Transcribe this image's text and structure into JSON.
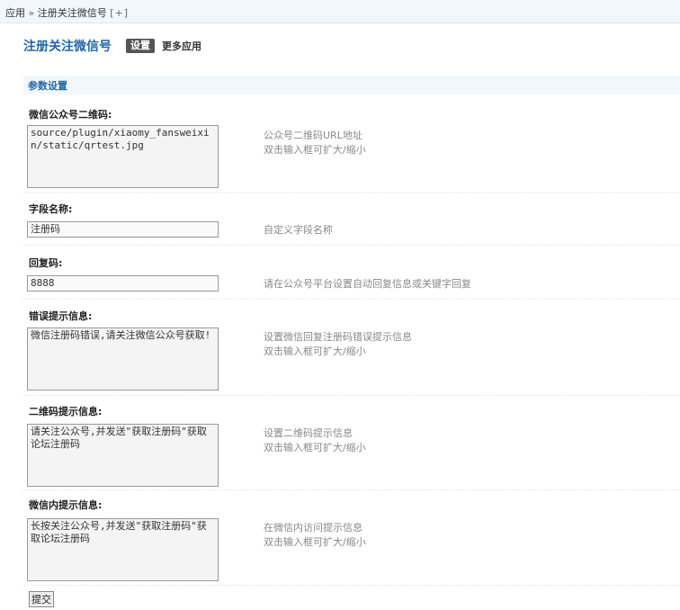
{
  "breadcrumb": {
    "root": "应用",
    "separator": "»",
    "current": "注册关注微信号",
    "add": "[+]"
  },
  "header": {
    "title": "注册关注微信号",
    "tab_active": "设置",
    "tab_more": "更多应用"
  },
  "section": {
    "title": "参数设置"
  },
  "fields": [
    {
      "label": "微信公众号二维码:",
      "value": "source/plugin/xiaomy_fansweixin/static/qrtest.jpg",
      "tip1": "公众号二维码URL地址",
      "tip2": "双击输入框可扩大/缩小"
    },
    {
      "label": "字段名称:",
      "value": "注册码",
      "tip1": "自定义字段名称"
    },
    {
      "label": "回复码:",
      "value": "8888",
      "tip1": "请在公众号平台设置自动回复信息或关键字回复"
    },
    {
      "label": "错误提示信息:",
      "value": "微信注册码错误,请关注微信公众号获取!",
      "tip1": "设置微信回复注册码错误提示信息",
      "tip2": "双击输入框可扩大/缩小"
    },
    {
      "label": "二维码提示信息:",
      "value": "请关注公众号,并发送\"获取注册码\"获取论坛注册码",
      "tip1": "设置二维码提示信息",
      "tip2": "双击输入框可扩大/缩小"
    },
    {
      "label": "微信内提示信息:",
      "value": "长按关注公众号,并发送\"获取注册码\"获取论坛注册码",
      "tip1": "在微信内访问提示信息",
      "tip2": "双击输入框可扩大/缩小"
    }
  ],
  "submit_label": "提交"
}
